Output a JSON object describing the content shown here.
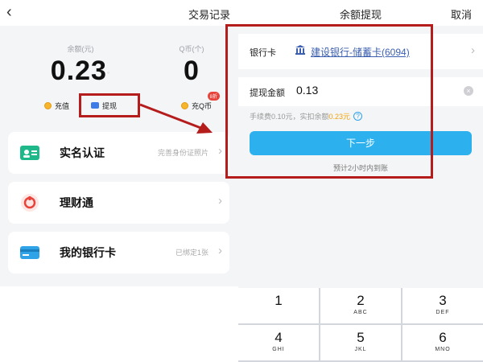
{
  "left": {
    "back_icon": "‹",
    "transactions_link": "交易记录",
    "balance": {
      "label": "余额(元)",
      "value": "0.23"
    },
    "qcoin": {
      "label": "Q币(个)",
      "value": "0"
    },
    "actions": {
      "recharge": "充值",
      "withdraw": "提现",
      "recharge_qcoin": "充Q币",
      "badge": "8折"
    },
    "cards": [
      {
        "title": "实名认证",
        "subtitle": "完善身份证照片",
        "icon": "id-card-icon"
      },
      {
        "title": "理财通",
        "subtitle": "",
        "icon": "wealth-icon"
      },
      {
        "title": "我的银行卡",
        "subtitle": "已绑定1张",
        "icon": "bank-card-icon"
      }
    ]
  },
  "right": {
    "title": "余额提现",
    "cancel": "取消",
    "bank_label": "银行卡",
    "bank_name": "建设银行-储蓄卡(6094)",
    "amount_label": "提现金额",
    "amount_value": "0.13",
    "fee_text": "手续费0.10元，实扣余额",
    "fee_amount": "0.23元",
    "next_button": "下一步",
    "eta": "预计2小时内到账",
    "keypad": [
      {
        "digit": "1",
        "letters": ""
      },
      {
        "digit": "2",
        "letters": "ABC"
      },
      {
        "digit": "3",
        "letters": "DEF"
      },
      {
        "digit": "4",
        "letters": "GHI"
      },
      {
        "digit": "5",
        "letters": "JKL"
      },
      {
        "digit": "6",
        "letters": "MNO"
      }
    ]
  },
  "colors": {
    "accent_blue": "#2cb1ee",
    "annotation_red": "#b51d1d",
    "fee_orange": "#f2a20c",
    "link_blue": "#3c5fb0"
  }
}
